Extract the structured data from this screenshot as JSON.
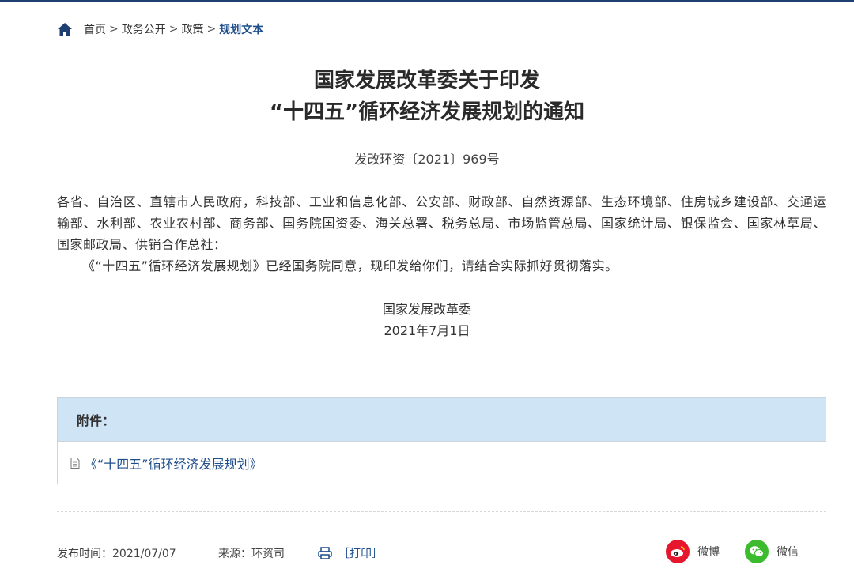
{
  "breadcrumb": {
    "items": [
      "首页",
      "政务公开",
      "政策"
    ],
    "current": "规划文本",
    "separator": ">"
  },
  "title": {
    "line1": "国家发展改革委关于印发",
    "line2": "“十四五”循环经济发展规划的通知"
  },
  "doc_number": "发改环资〔2021〕969号",
  "body": {
    "recipients": "各省、自治区、直辖市人民政府，科技部、工业和信息化部、公安部、财政部、自然资源部、生态环境部、住房城乡建设部、交通运输部、水利部、农业农村部、商务部、国务院国资委、海关总署、税务总局、市场监管总局、国家统计局、银保监会、国家林草局、国家邮政局、供销合作总社：",
    "paragraph": "《“十四五”循环经济发展规划》已经国务院同意，现印发给你们，请结合实际抓好贯彻落实。"
  },
  "signature": {
    "org": "国家发展改革委",
    "date": "2021年7月1日"
  },
  "attachment": {
    "heading": "附件：",
    "file": "《“十四五”循环经济发展规划》",
    "icon": "document-icon"
  },
  "footer": {
    "pub_time": "发布时间：2021/07/07",
    "source": "来源：环资司",
    "print": "［打印］",
    "share_weibo": "微博",
    "share_wechat": "微信"
  },
  "colors": {
    "accent": "#1f4e8c",
    "attach_header_bg": "#cfe4f4",
    "weibo": "#e6162d",
    "wechat": "#3dbb2f"
  }
}
